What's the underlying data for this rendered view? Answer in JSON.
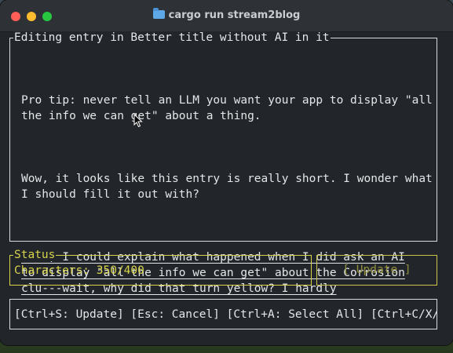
{
  "window": {
    "title": "cargo run stream2blog"
  },
  "editor": {
    "box_title": "Editing entry in Better title without AI in it",
    "paragraphs": [
      {
        "lines": [
          "Pro tip: never tell an LLM you want your app to display \"all",
          "the info we can get\" about a thing."
        ]
      },
      {
        "lines": [
          "Wow, it looks like this entry is really short. I wonder what",
          "I should fill it out with?"
        ]
      },
      {
        "lines": [
          "Well, I could explain what happened when I did ask an AI",
          "to display \"all the info we can get\" about the Corrosion",
          "clu---wait, why did that turn yellow? I hardly"
        ]
      }
    ]
  },
  "status": {
    "box_title": "Status",
    "characters_text": "Characters: 350/400"
  },
  "update_button": {
    "label": "[ Update ]"
  },
  "help_bar": {
    "text": "[Ctrl+S: Update] [Esc: Cancel] [Ctrl+A: Select All] [Ctrl+C/X/V"
  },
  "colors": {
    "warning_yellow": "#d7d44a",
    "terminal_bg": "#22262b",
    "terminal_fg": "#e4e6e8"
  },
  "icons": {
    "title": "folder-icon",
    "pointer": "mouse-pointer-icon"
  }
}
